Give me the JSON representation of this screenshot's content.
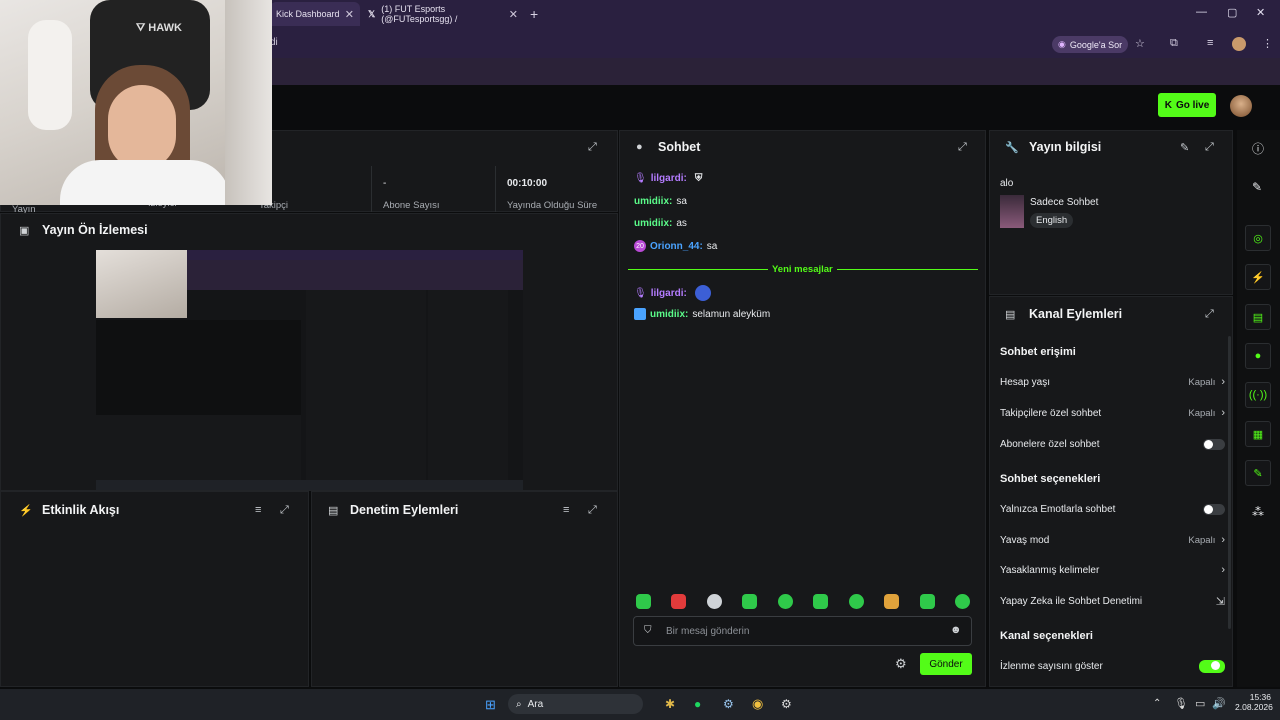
{
  "browser": {
    "tabs": [
      {
        "title": "Kick Dashboard",
        "active": true
      },
      {
        "title": "(1) FUT Esports (@FUTesportsgg) /",
        "active": false
      }
    ],
    "url_fragment": "di",
    "google_button": "Google'a Sor"
  },
  "header": {
    "go_live_label": "Go live"
  },
  "stats": [
    {
      "value": "-",
      "label": "Abone Sayısı"
    },
    {
      "value": "00:10:00",
      "label": "Yayında Olduğu Süre"
    }
  ],
  "stats_partial_labels": [
    "Yayın",
    "İzleyici",
    "Takipçi"
  ],
  "preview": {
    "title": "Yayın Ön İzlemesi"
  },
  "chat": {
    "title": "Sohbet",
    "messages": [
      {
        "user": "lilgardi:",
        "text": "",
        "style": "u2"
      },
      {
        "user": "umidiix:",
        "text": "sa",
        "style": "u"
      },
      {
        "user": "umidiix:",
        "text": "as",
        "style": "u"
      },
      {
        "user": "Orionn_44:",
        "text": "sa",
        "style": "u3"
      }
    ],
    "new_messages_label": "Yeni mesajlar",
    "messages_after": [
      {
        "user": "lilgardi:",
        "text": "",
        "style": "u2"
      },
      {
        "user": "umidiix:",
        "text": "selamun aleyküm",
        "style": "u"
      }
    ],
    "input_placeholder": "Bir mesaj gönderin",
    "send_label": "Gönder"
  },
  "stream_info": {
    "title": "Yayın bilgisi",
    "stream_title": "alo",
    "category": "Sadece Sohbet",
    "language": "English"
  },
  "channel_actions": {
    "title": "Kanal Eylemleri",
    "chat_access": {
      "heading": "Sohbet erişimi",
      "account_age": {
        "label": "Hesap yaşı",
        "value": "Kapalı"
      },
      "followers_only": {
        "label": "Takipçilere özel sohbet",
        "value": "Kapalı"
      },
      "subscribers_only": {
        "label": "Abonelere özel sohbet",
        "on": false
      }
    },
    "chat_options": {
      "heading": "Sohbet seçenekleri",
      "emote_only": {
        "label": "Yalnızca Emotlarla sohbet",
        "on": false
      },
      "slow_mode": {
        "label": "Yavaş mod",
        "value": "Kapalı"
      },
      "banned_words": {
        "label": "Yasaklanmış kelimeler"
      },
      "ai_moderation": {
        "label": "Yapay Zeka ile Sohbet Denetimi"
      }
    },
    "channel_options": {
      "heading": "Kanal seçenekleri",
      "show_viewers": {
        "label": "İzlenme sayısını göster",
        "on": true
      }
    }
  },
  "activity": {
    "title": "Etkinlik Akışı"
  },
  "moderation": {
    "title": "Denetim Eylemleri"
  },
  "taskbar": {
    "search": "Ara",
    "time": "15:36",
    "date": "2.08.2026"
  },
  "colors": {
    "accent": "#53fc18",
    "panel": "#17181a",
    "background": "#0b0c0d"
  }
}
